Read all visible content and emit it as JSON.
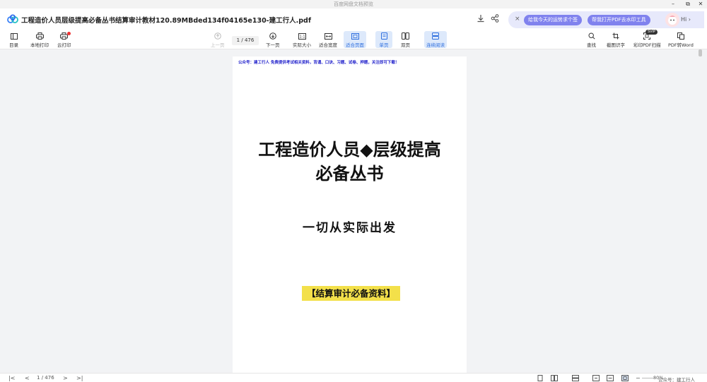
{
  "window": {
    "title": "百度网盘文档预览",
    "controls": {
      "minimize": "–",
      "maximize": "⧉",
      "close": "✕"
    }
  },
  "header": {
    "doc_title": "工程造价人员层级提高必备丛书结算审计教材120.89MBded134f04165e130-建工行人.pdf",
    "icons": [
      "logo-icon",
      "download-icon",
      "share-icon"
    ],
    "promo": {
      "close": "×",
      "pill1": "给我今天的运势求个签",
      "pill2": "帮我打开PDF去水印工具",
      "greeting": "Hi"
    }
  },
  "toolbar": {
    "left": [
      {
        "label": "目录",
        "icon": "outline-icon"
      },
      {
        "label": "本地打印",
        "icon": "print-icon"
      },
      {
        "label": "云打印",
        "icon": "cloud-print-icon"
      }
    ],
    "prev": "上一页",
    "page_current": "1",
    "page_separator": "/",
    "page_total": "476",
    "next": "下一页",
    "view": [
      {
        "label": "实际大小",
        "icon": "actual-size-icon"
      },
      {
        "label": "适合宽度",
        "icon": "fit-width-icon"
      },
      {
        "label": "适合页面",
        "icon": "fit-page-icon",
        "active": true
      },
      {
        "label": "单页",
        "icon": "single-page-icon",
        "active": true
      },
      {
        "label": "双页",
        "icon": "double-page-icon"
      },
      {
        "label": "连续阅读",
        "icon": "continuous-icon",
        "active": true
      }
    ],
    "right": [
      {
        "label": "查找",
        "icon": "search-icon"
      },
      {
        "label": "截图识字",
        "icon": "ocr-icon"
      },
      {
        "label": "彩印PDF扫描",
        "icon": "scan-icon",
        "badge": "SVIP"
      },
      {
        "label": "PDF转Word",
        "icon": "pdf-word-icon"
      }
    ]
  },
  "document": {
    "notice": "公众号：建工行人 免费提供考试相关资料，背诵、口诀、习题、试卷、押题，关注即可下载！",
    "title_line1": "工程造价人员◆层级提高",
    "title_line2": "必备丛书",
    "subtitle": "一切从实际出发",
    "highlight": "【结算审计必备资料】"
  },
  "statusbar": {
    "page_current": "1",
    "page_total": "476",
    "zoom": "80%",
    "watermark": "公众号：建工行人"
  },
  "colors": {
    "accent": "#2f6fde",
    "promo_pill": "#8082ee",
    "highlight": "#f3e04a",
    "notice_text": "#2222cc"
  }
}
